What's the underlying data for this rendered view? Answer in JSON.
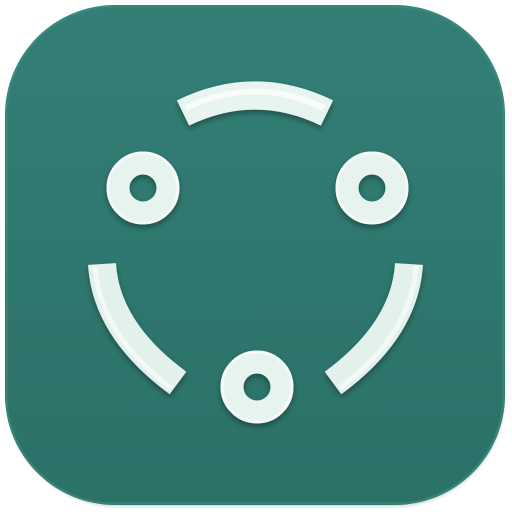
{
  "app_icon": {
    "icon_name": "ring-of-nodes-app-icon",
    "colors": {
      "tile": "#2f7b72",
      "tile_edge": "#286c63",
      "mark_fill": "#e3f1ec",
      "mark_highlight": "#ffffff",
      "mark_shadow": "#1c5049"
    },
    "elements": {
      "nodes": [
        "node-left",
        "node-right",
        "node-bottom"
      ],
      "arcs": [
        "arc-top",
        "arc-left",
        "arc-right"
      ]
    }
  }
}
